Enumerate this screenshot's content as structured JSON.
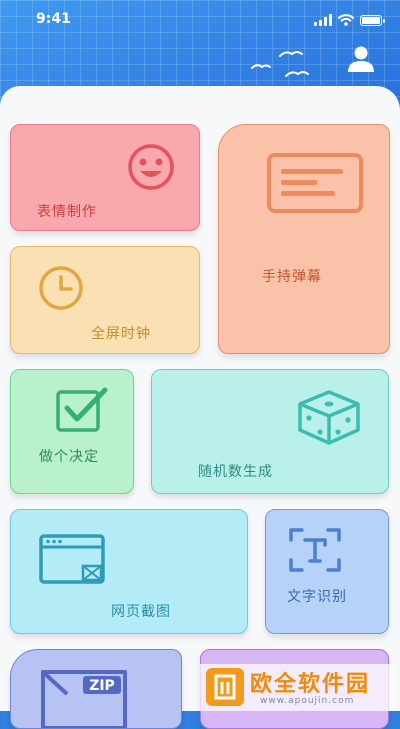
{
  "status_bar": {
    "time": "9:41"
  },
  "cards": {
    "emoji": {
      "label": "表情制作",
      "icon": "smiley-face-icon"
    },
    "barrage": {
      "label": "手持弹幕",
      "icon": "barrage-screen-icon"
    },
    "clock": {
      "label": "全屏时钟",
      "icon": "clock-icon"
    },
    "decide": {
      "label": "做个决定",
      "icon": "checkbox-check-icon"
    },
    "random": {
      "label": "随机数生成",
      "icon": "dice-icon"
    },
    "screenshot": {
      "label": "网页截图",
      "icon": "browser-window-icon"
    },
    "ocr": {
      "label": "文字识别",
      "icon": "text-scan-icon"
    },
    "zip": {
      "icon": "zip-file-icon",
      "icon_text": "ZIP"
    }
  },
  "watermark": {
    "title": "欧全软件园",
    "url": "www.apoujin.com"
  },
  "colors": {
    "header": "#2b83e8",
    "emoji": "#f9a8ae",
    "barrage": "#fac3a9",
    "clock": "#fae1b3",
    "decide": "#b8f1cb",
    "random": "#b9f1ea",
    "screenshot": "#b3ecf6",
    "ocr": "#b7d2f8",
    "zip": "#b7c3f3",
    "extra": "#d6b6f4"
  }
}
